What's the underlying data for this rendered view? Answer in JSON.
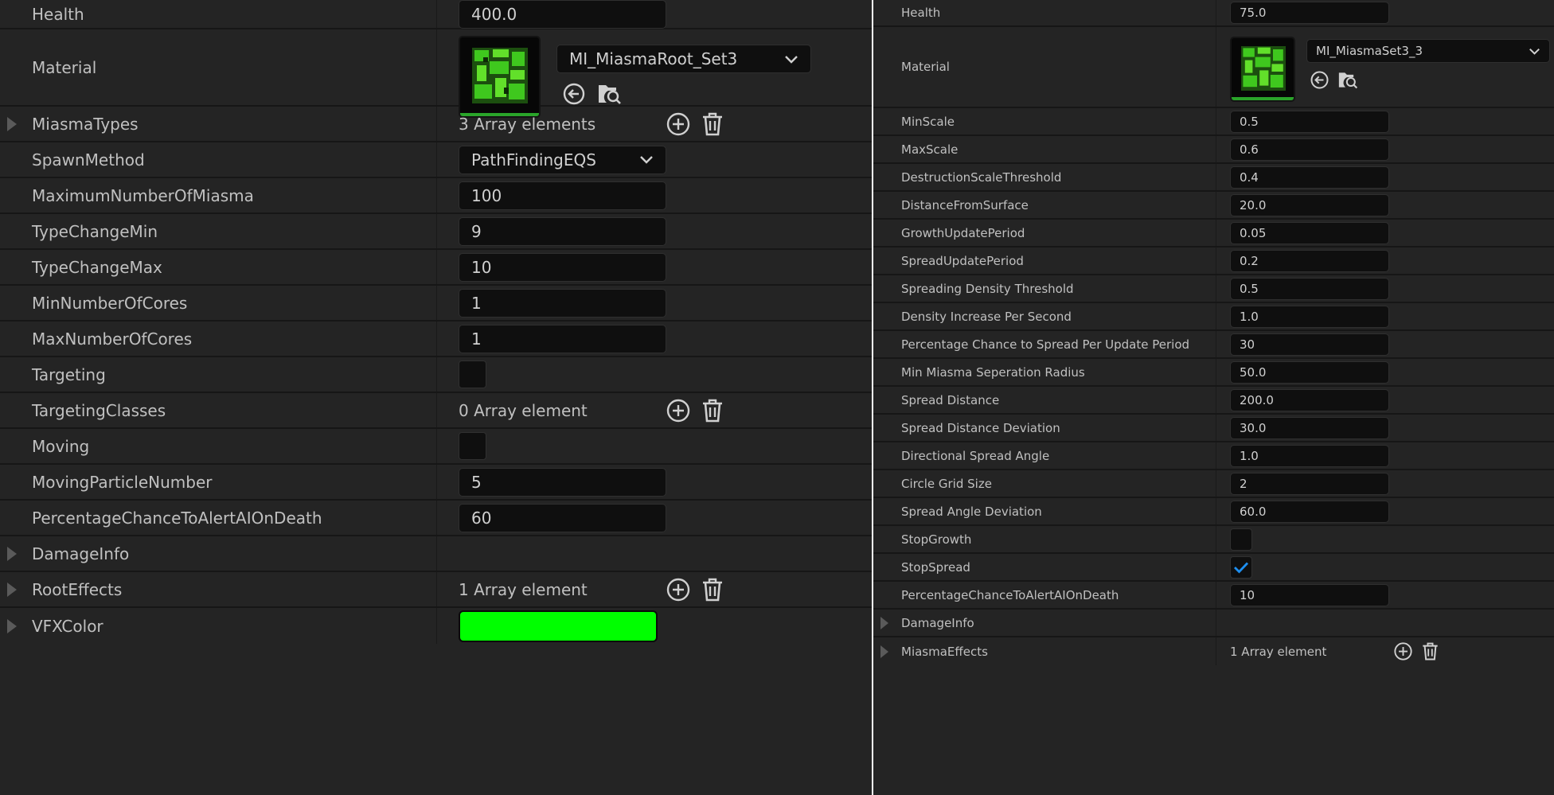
{
  "left": {
    "health": {
      "label": "Health",
      "value": "400.0"
    },
    "material": {
      "label": "Material",
      "asset": "MI_MiasmaRoot_Set3"
    },
    "miasma_types": {
      "label": "MiasmaTypes",
      "summary": "3 Array elements"
    },
    "spawn_method": {
      "label": "SpawnMethod",
      "value": "PathFindingEQS"
    },
    "rows": [
      {
        "label": "MaximumNumberOfMiasma",
        "value": "100"
      },
      {
        "label": "TypeChangeMin",
        "value": "9"
      },
      {
        "label": "TypeChangeMax",
        "value": "10"
      },
      {
        "label": "MinNumberOfCores",
        "value": "1"
      },
      {
        "label": "MaxNumberOfCores",
        "value": "1"
      }
    ],
    "targeting": {
      "label": "Targeting",
      "checked": false
    },
    "targeting_classes": {
      "label": "TargetingClasses",
      "summary": "0 Array element"
    },
    "moving": {
      "label": "Moving",
      "checked": false
    },
    "moving_particle_number": {
      "label": "MovingParticleNumber",
      "value": "5"
    },
    "percentage_alert": {
      "label": "PercentageChanceToAlertAIOnDeath",
      "value": "60"
    },
    "damage_info": {
      "label": "DamageInfo"
    },
    "root_effects": {
      "label": "RootEffects",
      "summary": "1 Array element"
    },
    "vfx_color": {
      "label": "VFXColor",
      "color": "#00ff00"
    }
  },
  "right": {
    "health": {
      "label": "Health",
      "value": "75.0"
    },
    "material": {
      "label": "Material",
      "asset": "MI_MiasmaSet3_3"
    },
    "rows": [
      {
        "label": "MinScale",
        "value": "0.5"
      },
      {
        "label": "MaxScale",
        "value": "0.6"
      },
      {
        "label": "DestructionScaleThreshold",
        "value": "0.4"
      },
      {
        "label": "DistanceFromSurface",
        "value": "20.0"
      },
      {
        "label": "GrowthUpdatePeriod",
        "value": "0.05"
      },
      {
        "label": "SpreadUpdatePeriod",
        "value": "0.2"
      },
      {
        "label": "Spreading Density Threshold",
        "value": "0.5"
      },
      {
        "label": "Density Increase Per Second",
        "value": "1.0"
      },
      {
        "label": "Percentage Chance to Spread Per Update Period",
        "value": "30"
      },
      {
        "label": "Min Miasma Seperation Radius",
        "value": "50.0"
      },
      {
        "label": "Spread Distance",
        "value": "200.0"
      },
      {
        "label": "Spread Distance Deviation",
        "value": "30.0"
      },
      {
        "label": "Directional Spread Angle",
        "value": "1.0"
      },
      {
        "label": "Circle Grid Size",
        "value": "2"
      },
      {
        "label": "Spread Angle Deviation",
        "value": "60.0"
      }
    ],
    "stop_growth": {
      "label": "StopGrowth",
      "checked": false
    },
    "stop_spread": {
      "label": "StopSpread",
      "checked": true
    },
    "percentage_alert": {
      "label": "PercentageChanceToAlertAIOnDeath",
      "value": "10"
    },
    "damage_info": {
      "label": "DamageInfo"
    },
    "miasma_effects": {
      "label": "MiasmaEffects",
      "summary": "1 Array element"
    }
  },
  "theme": {
    "check_color": "#1e8ff0",
    "texture_green": "#3fc81e",
    "thumb_bar": "#2aa52a"
  },
  "icons": [
    "expand-arrow-icon",
    "chevron-down-icon",
    "browse-back-icon",
    "find-in-browser-icon",
    "add-icon",
    "trash-icon",
    "checkmark-icon"
  ]
}
